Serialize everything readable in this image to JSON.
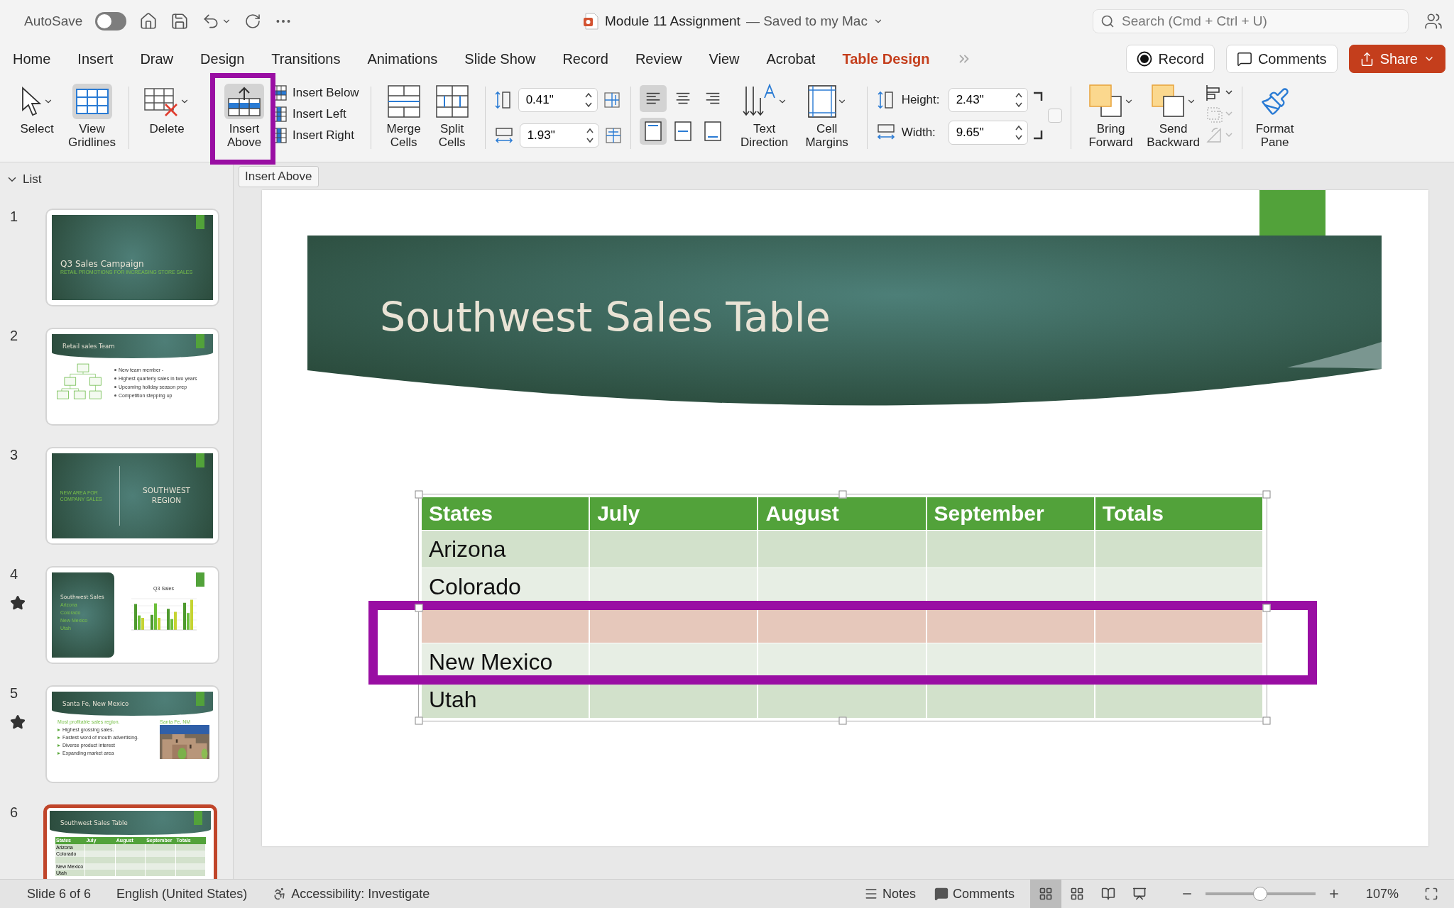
{
  "title_bar": {
    "autosave": {
      "label": "AutoSave",
      "on": false
    },
    "document_title": "Module 11 Assignment",
    "save_status": "— Saved to my Mac",
    "search": {
      "placeholder": "Search (Cmd + Ctrl + U)"
    }
  },
  "ribbon_tabs": [
    {
      "label": "Home",
      "selected": false
    },
    {
      "label": "Insert",
      "selected": false
    },
    {
      "label": "Draw",
      "selected": false
    },
    {
      "label": "Design",
      "selected": false
    },
    {
      "label": "Transitions",
      "selected": false
    },
    {
      "label": "Animations",
      "selected": false
    },
    {
      "label": "Slide Show",
      "selected": false
    },
    {
      "label": "Record",
      "selected": false
    },
    {
      "label": "Review",
      "selected": false
    },
    {
      "label": "View",
      "selected": false
    },
    {
      "label": "Acrobat",
      "selected": false
    },
    {
      "label": "Table Design",
      "selected": true
    }
  ],
  "header_buttons": [
    {
      "kind": "record",
      "label": "Record"
    },
    {
      "kind": "comments",
      "label": "Comments"
    },
    {
      "kind": "share",
      "label": "Share"
    }
  ],
  "ribbon": {
    "select": {
      "label": "Select"
    },
    "view_gridlines": {
      "label": "View Gridlines",
      "selected": true
    },
    "delete": {
      "label": "Delete"
    },
    "insert_above": {
      "label": "Insert Above"
    },
    "insert_options": [
      {
        "kind": "below",
        "label": "Insert Below"
      },
      {
        "kind": "left",
        "label": "Insert Left"
      },
      {
        "kind": "right",
        "label": "Insert Right"
      }
    ],
    "merge_cells": {
      "label": "Merge Cells"
    },
    "split_cells": {
      "label": "Split Cells"
    },
    "cell_size": [
      {
        "kind": "height",
        "value": "0.41\""
      },
      {
        "kind": "width",
        "value": "1.93\""
      }
    ],
    "cell_alignment": [
      {
        "kind": "left",
        "selected": true
      },
      {
        "kind": "center",
        "selected": false
      },
      {
        "kind": "right",
        "selected": false
      },
      {
        "kind": "top",
        "selected": true
      },
      {
        "kind": "middle",
        "selected": false
      },
      {
        "kind": "bottom",
        "selected": false
      }
    ],
    "text_direction": {
      "label": "Text Direction"
    },
    "cell_margins": {
      "label": "Cell Margins"
    },
    "table_size": [
      {
        "kind": "height",
        "label": "Height:",
        "value": "2.43\""
      },
      {
        "kind": "width",
        "label": "Width:",
        "value": "9.65\""
      }
    ],
    "lock_aspect_ratio": {
      "checked": false
    },
    "bring_forward": {
      "label": "Bring Forward"
    },
    "send_backward": {
      "label": "Send Backward"
    },
    "arrange_tools": [
      {
        "kind": "align",
        "disabled": false
      },
      {
        "kind": "group",
        "disabled": true
      },
      {
        "kind": "rotate",
        "disabled": true
      }
    ],
    "format_pane": {
      "label": "Format Pane"
    }
  },
  "tooltip": "Insert Above",
  "slides_panel": {
    "header": "List",
    "slides": [
      {
        "number": "1",
        "selected": false,
        "animated": false,
        "kind": "title",
        "title": "Q3 Sales Campaign",
        "subtitle": "RETAIL PROMOTIONS FOR INCREASING STORE SALES"
      },
      {
        "number": "2",
        "selected": false,
        "animated": false,
        "kind": "org",
        "title": "Retail sales Team",
        "bullets": [
          "New team member -",
          "Highest quarterly sales in two years",
          "Upcoming holiday season prep",
          "Competition stepping up"
        ]
      },
      {
        "number": "3",
        "selected": false,
        "animated": false,
        "kind": "section",
        "caption": "NEW AREA FOR COMPANY SALES",
        "title": "SOUTHWEST REGION"
      },
      {
        "number": "4",
        "selected": false,
        "animated": true,
        "kind": "chart",
        "title": "Southwest Sales",
        "items": [
          "Arizona",
          "Colorado",
          "New Mexico",
          "Utah"
        ],
        "chart_title": "Q3 Sales"
      },
      {
        "number": "5",
        "selected": false,
        "animated": true,
        "title": "Santa Fe, New Mexico",
        "heading": "Most profitable sales region.",
        "bullets": [
          "Highest grossing sales.",
          "Fastest word of mouth advertising.",
          "Diverse product interest",
          "Expanding market area"
        ],
        "photo_caption": "Santa Fe, NM"
      },
      {
        "number": "6",
        "selected": true,
        "animated": false,
        "kind": "table",
        "title": "Southwest Sales Table",
        "columns": [
          "States",
          "July",
          "August",
          "September",
          "Totals"
        ],
        "rows": [
          {
            "kind": "data",
            "state": "Arizona"
          },
          {
            "kind": "data",
            "state": "Colorado"
          },
          {
            "kind": "empty"
          },
          {
            "kind": "data",
            "state": "New Mexico"
          },
          {
            "kind": "data",
            "state": "Utah"
          }
        ]
      }
    ]
  },
  "slide": {
    "title": "Southwest Sales Table",
    "table": {
      "columns": [
        "States",
        "July",
        "August",
        "September",
        "Totals"
      ],
      "rows": [
        {
          "kind": "data",
          "state": "Arizona",
          "selected": false
        },
        {
          "kind": "data",
          "state": "Colorado",
          "selected": false
        },
        {
          "kind": "empty",
          "selected": true
        },
        {
          "kind": "data",
          "state": "New Mexico",
          "selected": false
        },
        {
          "kind": "data",
          "state": "Utah",
          "selected": false
        }
      ]
    }
  },
  "status_bar": {
    "slide_position": "Slide 6 of 6",
    "language": "English (United States)",
    "accessibility": "Accessibility: Investigate",
    "notes": "Notes",
    "comments": "Comments",
    "views": [
      {
        "kind": "normal",
        "selected": true
      },
      {
        "kind": "sorter",
        "selected": false
      },
      {
        "kind": "reading",
        "selected": false
      },
      {
        "kind": "presenter",
        "selected": false
      }
    ],
    "zoom": {
      "level": 0.5,
      "reading": "107%"
    }
  }
}
